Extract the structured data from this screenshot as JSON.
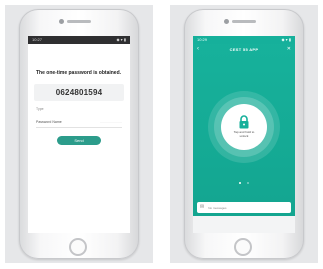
{
  "left_phone": {
    "status": {
      "time": "10:27",
      "icons": "◆ ▾ ▮"
    },
    "title": "The one-time password is obtained.",
    "otp_value": "0624801594",
    "small_label": "Type",
    "password_label": "Password Name",
    "password_placeholder": "······················",
    "note": "",
    "send_button": "Send"
  },
  "right_phone": {
    "status": {
      "time": "10:29",
      "icons": "◆ ▾ ▮"
    },
    "title": "CEST 55 APP",
    "subtitle": "",
    "unlock_text": "Tap and hold to unlock",
    "messages_label": "No messages"
  },
  "colors": {
    "accent_teal": "#16b09b",
    "button_teal": "#2c9c8b",
    "status_dark": "#2f2f31"
  },
  "icons": [
    "back-icon",
    "close-icon",
    "lock-icon",
    "message-icon"
  ]
}
